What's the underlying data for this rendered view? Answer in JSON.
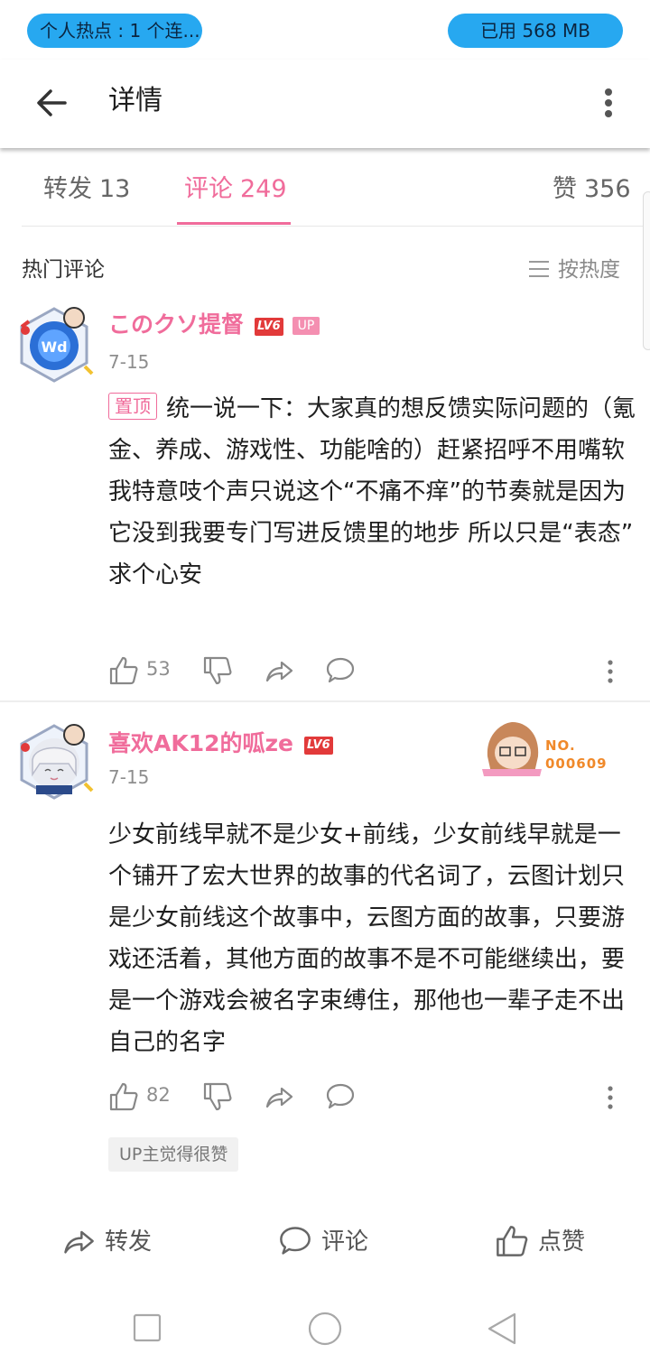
{
  "status_bar": {
    "hotspot_text": "个人热点 : 1 个连...",
    "memory_text": "已用 568 MB"
  },
  "app_bar": {
    "title": "详情",
    "back_icon": "arrow-left-icon",
    "more_icon": "more-vertical-icon"
  },
  "tabs": [
    {
      "label": "转发",
      "count": "13",
      "active": false
    },
    {
      "label": "评论",
      "count": "249",
      "active": true
    },
    {
      "label": "赞",
      "count": "356",
      "active": false
    }
  ],
  "section": {
    "title": "热门评论",
    "sort_label": "按热度"
  },
  "comments": [
    {
      "username": "このクソ提督",
      "level": "LV6",
      "up_badge": "UP",
      "date": "7-15",
      "pinned_label": "置顶",
      "text": "统一说一下：大家真的想反馈实际问题的（氪金、养成、游戏性、功能啥的）赶紧招呼不用嘴软\n我特意吱个声只说这个“不痛不痒”的节奏就是因为它没到我要专门写进反馈里的地步 所以只是“表态” 求个心安",
      "likes": "53"
    },
    {
      "username": "喜欢AK12的呱ze",
      "level": "LV6",
      "date": "7-15",
      "medal_text": "NO.\n000609",
      "text": "少女前线早就不是少女+前线，少女前线早就是一个铺开了宏大世界的故事的代名词了，云图计划只是少女前线这个故事中，云图方面的故事，只要游戏还活着，其他方面的故事不是不可能继续出，要是一个游戏会被名字束缚住，那他也一辈子走不出自己的名字",
      "likes": "82",
      "up_liked_label": "UP主觉得很赞"
    }
  ],
  "bottom_actions": {
    "repost": "转发",
    "comment": "评论",
    "like": "点赞"
  },
  "colors": {
    "accent_pink": "#f06c9b",
    "status_pill": "#27a8f0",
    "level_red": "#e23a3a",
    "text_gray": "#8e8e8e"
  }
}
